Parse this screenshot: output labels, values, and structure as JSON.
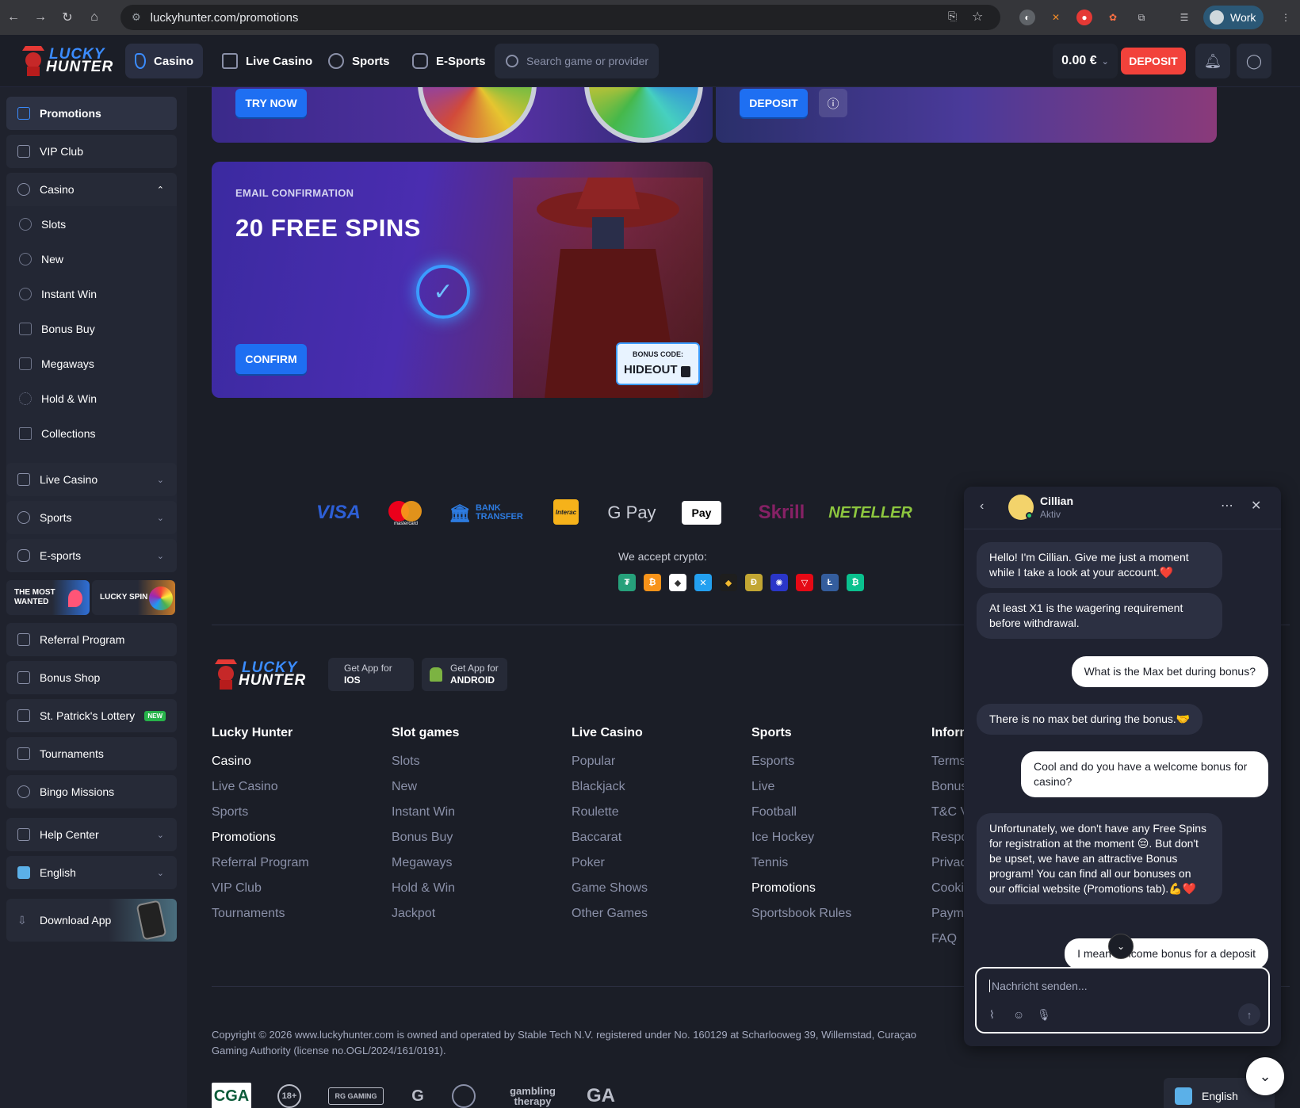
{
  "browser": {
    "url": "luckyhunter.com/promotions",
    "profile": "Work"
  },
  "brand": {
    "logo_line1": "LUCKY",
    "logo_line2": "HUNTER",
    "colors": {
      "accent_blue": "#1e6ff2",
      "deposit_red": "#f2423b",
      "bg": "#1b1e27"
    }
  },
  "topnav": {
    "tabs": [
      {
        "label": "Casino",
        "active": true
      },
      {
        "label": "Live Casino",
        "active": false
      },
      {
        "label": "Sports",
        "active": false
      },
      {
        "label": "E-Sports",
        "active": false
      }
    ],
    "search_placeholder": "Search game or provider",
    "balance": "0.00 €",
    "deposit_label": "DEPOSIT"
  },
  "sidebar": {
    "promotions": "Promotions",
    "vip_club": "VIP Club",
    "casino": "Casino",
    "casino_sub": [
      "Slots",
      "New",
      "Instant Win",
      "Bonus Buy",
      "Megaways",
      "Hold & Win",
      "Collections"
    ],
    "live_casino": "Live Casino",
    "sports": "Sports",
    "esports": "E-sports",
    "tile_wanted": "THE MOST WANTED",
    "tile_lucky_spin": "LUCKY SPIN",
    "referral": "Referral Program",
    "bonus_shop": "Bonus Shop",
    "lottery": "St. Patrick's Lottery",
    "new_badge": "NEW",
    "tournaments": "Tournaments",
    "bingo": "Bingo Missions",
    "help": "Help Center",
    "language": "English",
    "download": "Download App"
  },
  "promos": {
    "card1_button": "TRY NOW",
    "card2_button": "DEPOSIT",
    "email": {
      "kicker": "EMAIL CONFIRMATION",
      "title": "20 FREE SPINS",
      "button": "CONFIRM",
      "code_label": "BONUS CODE:",
      "code": "HIDEOUT"
    }
  },
  "payments": {
    "methods": [
      "VISA",
      "mastercard",
      "BANK TRANSFER",
      "Interac",
      "G Pay",
      "Pay",
      "Skrill",
      "NETELLER"
    ],
    "crypto_label": "We accept crypto:"
  },
  "footer": {
    "app_ios_small": "Get App for",
    "app_ios": "IOS",
    "app_android_small": "Get App for",
    "app_android": "ANDROID",
    "columns": [
      {
        "title": "Lucky Hunter",
        "links": [
          "Casino",
          "Live Casino",
          "Sports",
          "Promotions",
          "Referral Program",
          "VIP Club",
          "Tournaments"
        ]
      },
      {
        "title": "Slot games",
        "links": [
          "Slots",
          "New",
          "Instant Win",
          "Bonus Buy",
          "Megaways",
          "Hold & Win",
          "Jackpot"
        ]
      },
      {
        "title": "Live Casino",
        "links": [
          "Popular",
          "Blackjack",
          "Roulette",
          "Baccarat",
          "Poker",
          "Game Shows",
          "Other Games"
        ]
      },
      {
        "title": "Sports",
        "links": [
          "Esports",
          "Live",
          "Football",
          "Ice Hockey",
          "Tennis",
          "Promotions",
          "Sportsbook Rules"
        ]
      },
      {
        "title": "Inform",
        "links": [
          "Terms",
          "Bonus",
          "T&C V",
          "Respo",
          "Privac",
          "Cooki",
          "Payme",
          "FAQ"
        ]
      }
    ],
    "copyright_line1": "Copyright © 2026 www.luckyhunter.com is owned and operated by Stable Tech N.V. registered under No. 160129 at Scharlooweg 39, Willemstad, Curaçao",
    "copyright_line2": "Gaming Authority (license no.OGL/2024/161/0191).",
    "certs": [
      "CGA",
      "18+",
      "RG GAMING",
      "GAMCARE",
      "gambling therapy",
      "GA"
    ],
    "language": "English"
  },
  "chat": {
    "agent_name": "Cillian",
    "agent_status": "Aktiv",
    "messages": [
      {
        "from": "agent",
        "text": "Hello! I'm Cillian. Give me just a moment while I take a look at your account.❤️"
      },
      {
        "from": "agent",
        "text": "At least X1 is the wagering requirement before withdrawal."
      },
      {
        "from": "user",
        "text": "What is the Max bet during bonus?"
      },
      {
        "from": "agent",
        "text": "There is no max bet during the bonus.🤝"
      },
      {
        "from": "user",
        "text": "Cool and do you have a welcome bonus for casino?"
      },
      {
        "from": "agent",
        "text": "Unfortunately, we don't have any Free Spins for registration at the moment 😔. But don't be upset, we have an attractive Bonus program! You can find all our bonuses on our official website (Promotions tab).💪❤️"
      },
      {
        "from": "user",
        "text": "I mean welcome bonus for a deposit"
      }
    ],
    "input_placeholder": "Nachricht senden..."
  }
}
